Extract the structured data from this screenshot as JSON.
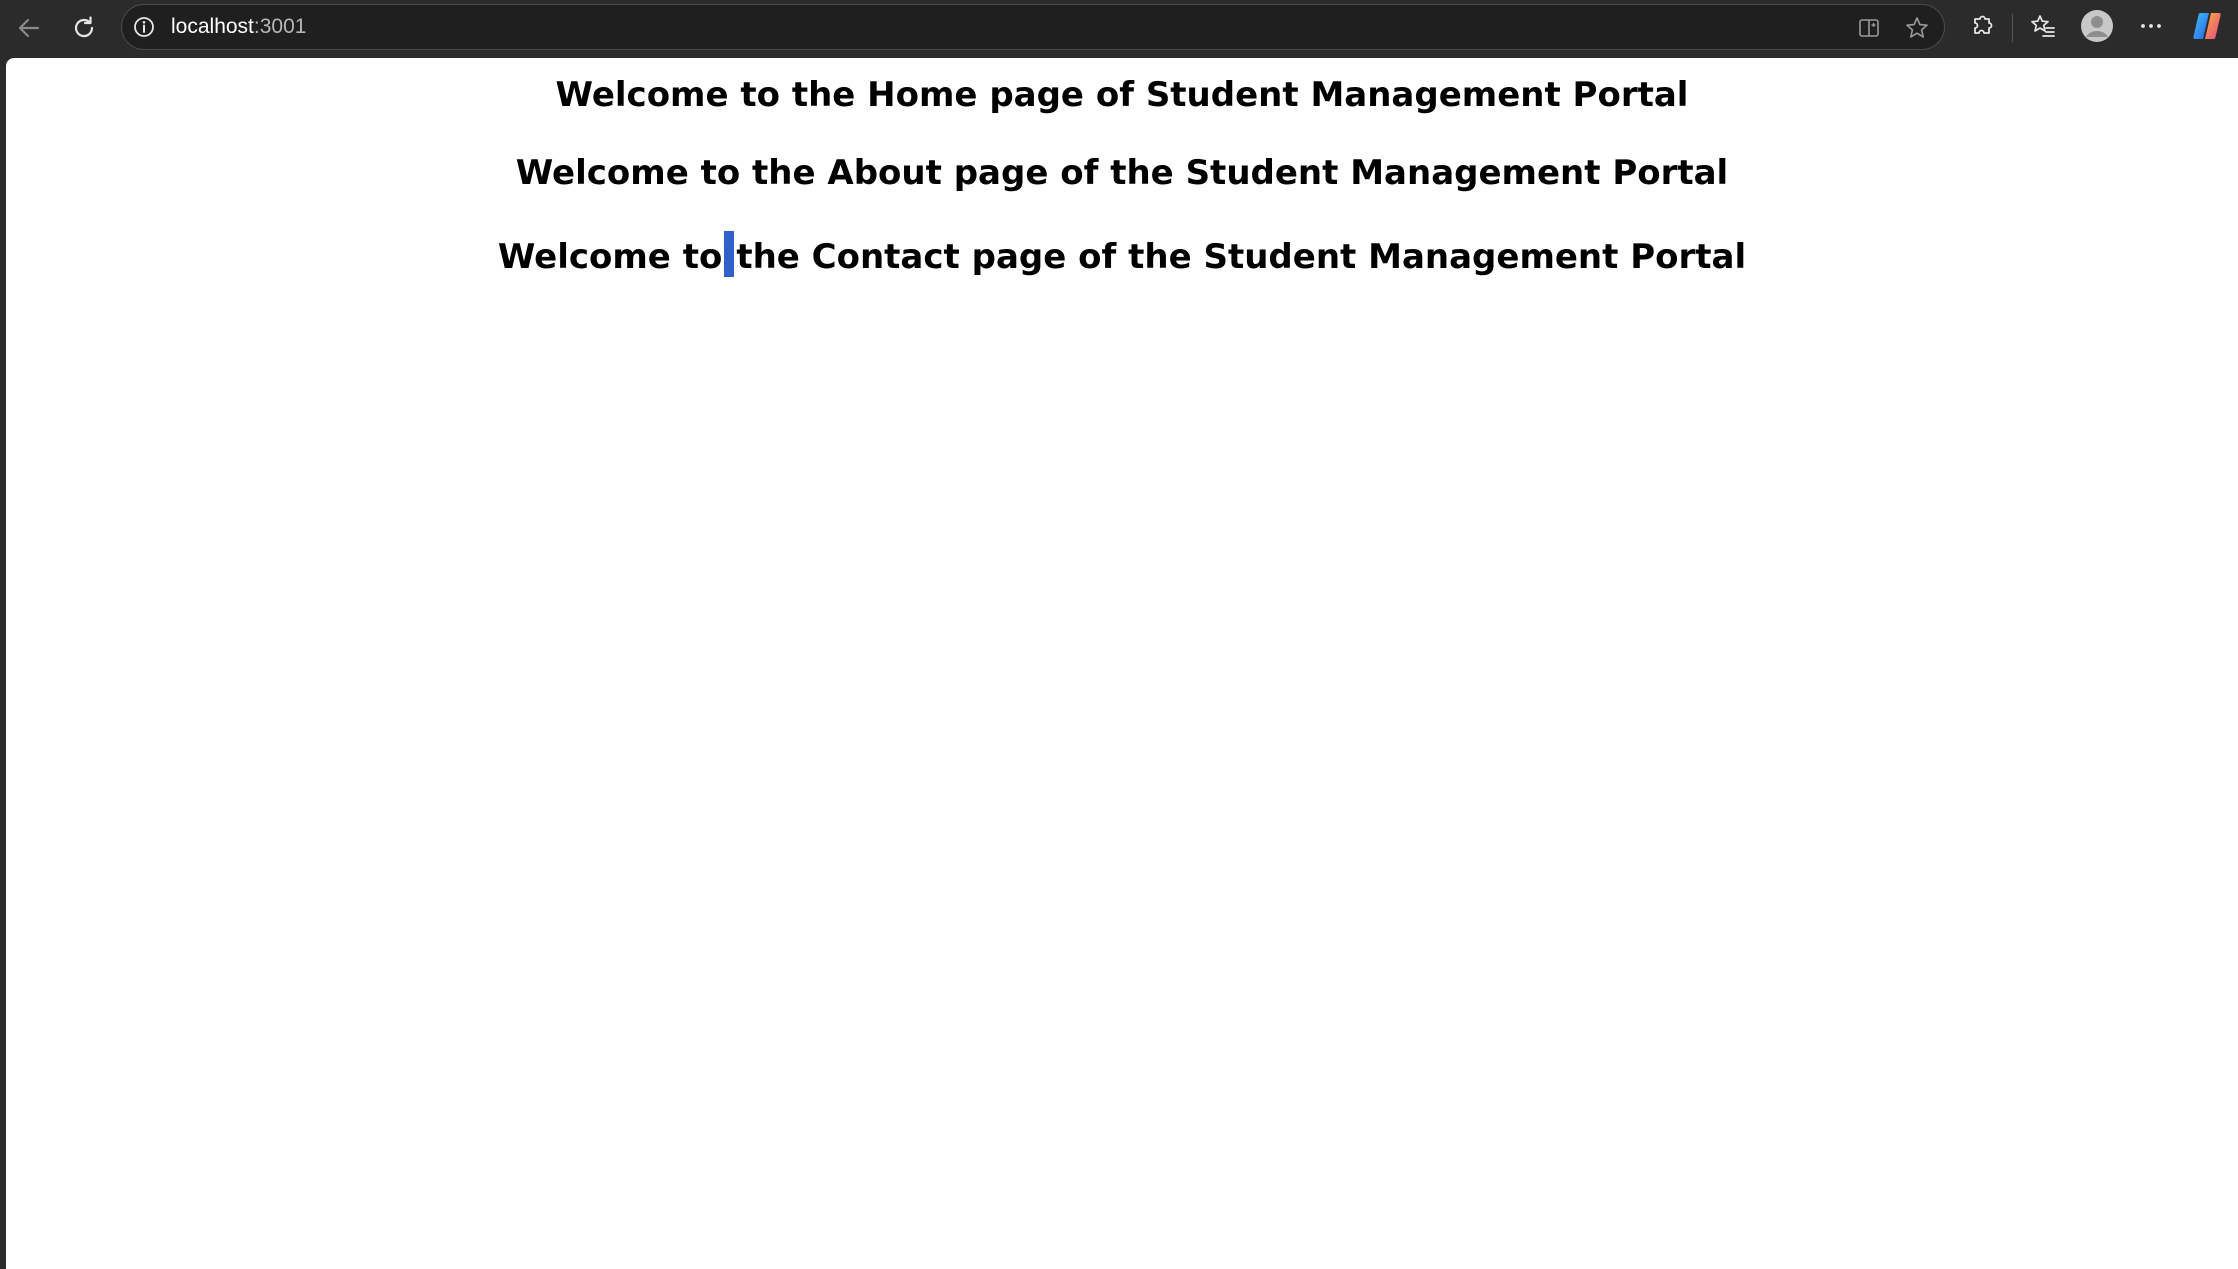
{
  "browser": {
    "url_host": "localhost",
    "url_port": ":3001",
    "colors": {
      "chrome_bg": "#2b2b2b",
      "page_bg": "#ffffff",
      "selection": "#2f5fc9"
    },
    "icons": {
      "back": "arrow-left-icon",
      "reload": "reload-icon",
      "site_info": "info-icon",
      "split_screen": "split-screen-icon",
      "favorite": "star-icon",
      "extensions": "puzzle-icon",
      "favorites": "favorites-list-icon",
      "profile": "avatar-icon",
      "menu": "more-icon",
      "copilot": "copilot-icon"
    }
  },
  "page": {
    "headings": [
      "Welcome to the Home page of Student Management Portal",
      "Welcome to the About page of the Student Management Portal",
      "Welcome to",
      "the Contact page of the Student Management Portal"
    ]
  }
}
